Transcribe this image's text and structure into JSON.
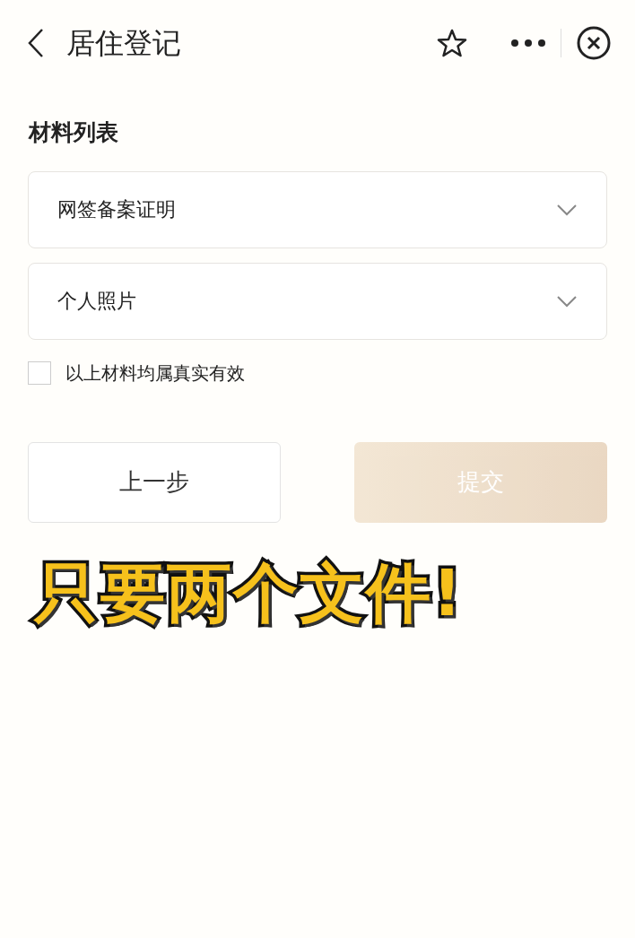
{
  "header": {
    "title": "居住登记"
  },
  "section": {
    "title": "材料列表"
  },
  "materials": [
    {
      "label": "网签备案证明",
      "expanded": false
    },
    {
      "label": "个人照片",
      "expanded": false
    }
  ],
  "agreement": {
    "label": "以上材料均属真实有效",
    "checked": false
  },
  "buttons": [
    {
      "label": "上一步",
      "kind": "secondary",
      "disabled": false
    },
    {
      "label": "提交",
      "kind": "primary",
      "disabled": true
    }
  ],
  "caption": "只要两个文件!"
}
